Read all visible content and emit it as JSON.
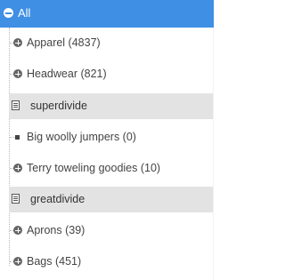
{
  "tree": {
    "root": {
      "label": "All",
      "icon": "minus-circle-icon"
    },
    "items": [
      {
        "type": "category",
        "label": "Apparel (4837)",
        "icon": "plus-circle-icon"
      },
      {
        "type": "category",
        "label": "Headwear (821)",
        "icon": "plus-circle-icon"
      },
      {
        "type": "divider",
        "label": "superdivide",
        "icon": "list-icon"
      },
      {
        "type": "leaf",
        "label": "Big woolly jumpers (0)",
        "icon": "square-bullet-icon"
      },
      {
        "type": "category",
        "label": "Terry toweling goodies (10)",
        "icon": "plus-circle-icon"
      },
      {
        "type": "divider",
        "label": "greatdivide",
        "icon": "list-icon"
      },
      {
        "type": "category",
        "label": "Aprons (39)",
        "icon": "plus-circle-icon"
      },
      {
        "type": "category",
        "label": "Bags (451)",
        "icon": "plus-circle-icon"
      }
    ]
  },
  "colors": {
    "selected": "#3f8fe4",
    "divider_bg": "#e3e3e3",
    "text": "#444444"
  }
}
